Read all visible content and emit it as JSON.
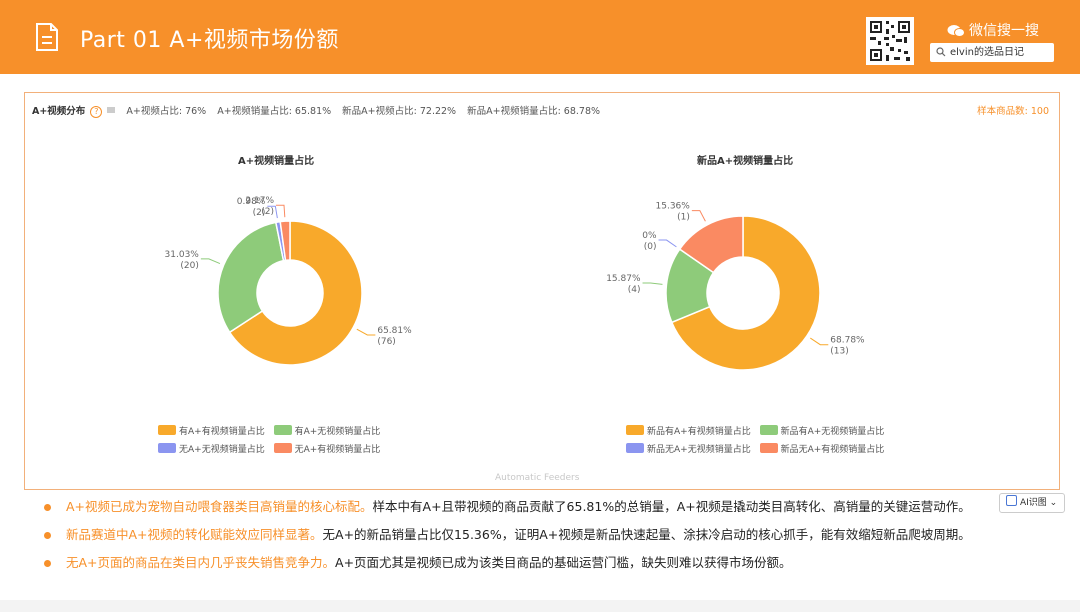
{
  "header": {
    "title": "Part 01  A+视频市场份额",
    "wechat_label": "微信搜一搜",
    "search_value": "elvin的选品日记"
  },
  "panel": {
    "section_label": "A+视频分布",
    "stats": [
      "A+视频占比: 76%",
      "A+视频销量占比: 65.81%",
      "新品A+视频占比: 72.22%",
      "新品A+视频销量占比: 68.78%"
    ],
    "sample_count": "样本商品数: 100",
    "watermark": "Automatic Feeders"
  },
  "chart_data": [
    {
      "type": "pie",
      "title": "A+视频销量占比",
      "categories": [
        "有A+有视频销量占比",
        "有A+无视频销量占比",
        "无A+无视频销量占比",
        "无A+有视频销量占比"
      ],
      "values": [
        65.81,
        31.03,
        0.98,
        2.17
      ],
      "counts": [
        76,
        20,
        2,
        2
      ],
      "labels": [
        [
          "65.81%",
          "(76)"
        ],
        [
          "31.03%",
          "(20)"
        ],
        [
          "0.98%",
          "(2)"
        ],
        [
          "2.17%",
          "(2)"
        ]
      ],
      "colors": [
        "#f8a92b",
        "#8ecb7a",
        "#8b95f0",
        "#fa8a62"
      ],
      "legend": "bottom"
    },
    {
      "type": "pie",
      "title": "新品A+视频销量占比",
      "categories": [
        "新品有A+有视频销量占比",
        "新品有A+无视频销量占比",
        "新品无A+无视频销量占比",
        "新品无A+有视频销量占比"
      ],
      "values": [
        68.78,
        15.87,
        0,
        15.36
      ],
      "counts": [
        13,
        4,
        0,
        1
      ],
      "labels": [
        [
          "68.78%",
          "(13)"
        ],
        [
          "15.87%",
          "(4)"
        ],
        [
          "0%",
          "(0)"
        ],
        [
          "15.36%",
          "(1)"
        ]
      ],
      "colors": [
        "#f8a92b",
        "#8ecb7a",
        "#8b95f0",
        "#fa8a62"
      ],
      "legend": "bottom"
    }
  ],
  "bullets": [
    {
      "highlight": "A+视频已成为宠物自动喂食器类目高销量的核心标配。",
      "text": "样本中有A+且带视频的商品贡献了65.81%的总销量，A+视频是撬动类目高转化、高销量的关键运营动作。"
    },
    {
      "highlight": "新品赛道中A+视频的转化赋能效应同样显著。",
      "text": "无A+的新品销量占比仅15.36%，证明A+视频是新品快速起量、涂抹冷启动的核心抓手，能有效缩短新品爬坡周期。"
    },
    {
      "highlight": "无A+页面的商品在类目内几乎丧失销售竞争力。",
      "text": "A+页面尤其是视频已成为该类目商品的基础运营门槛，缺失则难以获得市场份额。"
    }
  ],
  "ai_button": "AI识图",
  "colors": {
    "accent": "#f7902a"
  }
}
